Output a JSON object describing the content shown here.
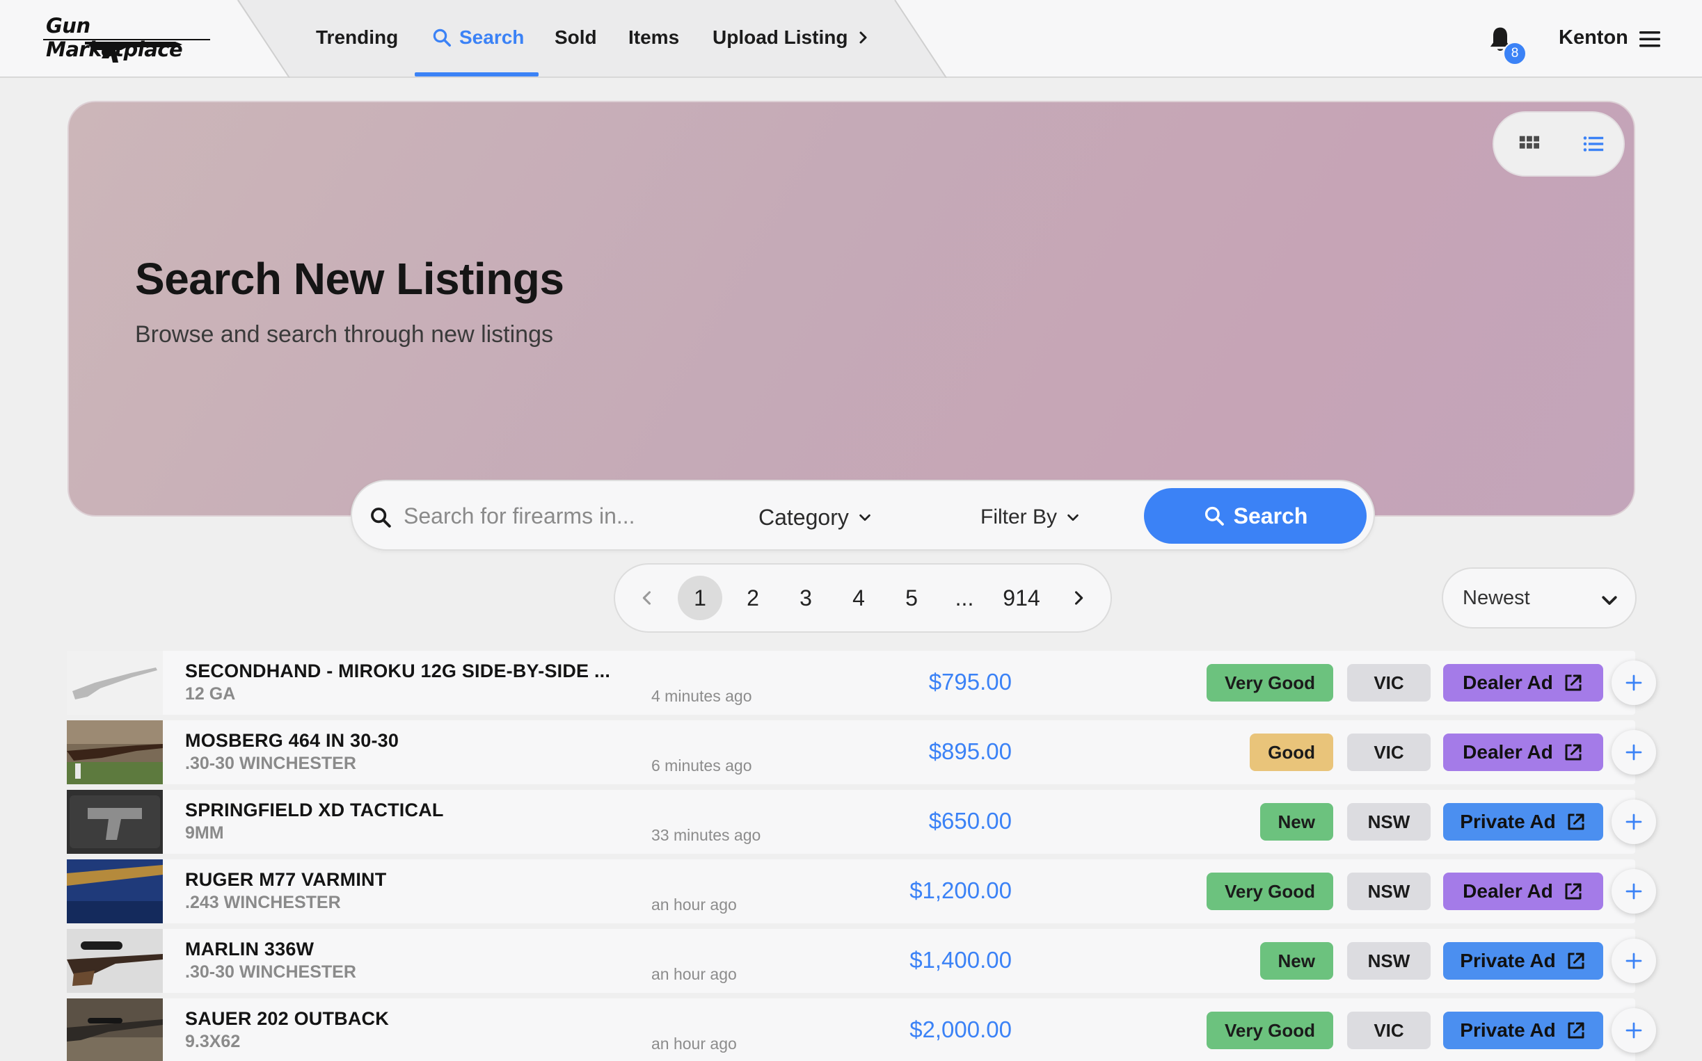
{
  "brand": {
    "name": "Gun Marketplace"
  },
  "nav": {
    "items": [
      {
        "label": "Trending",
        "icon": null
      },
      {
        "label": "Search",
        "icon": "search-icon",
        "active": true
      },
      {
        "label": "Sold"
      },
      {
        "label": "Items"
      },
      {
        "label": "Upload Listing",
        "icon": "chevron-right-icon"
      }
    ],
    "notifications_count": "8",
    "user_name": "Kenton"
  },
  "hero": {
    "title": "Search New Listings",
    "subtitle": "Browse and search through new listings"
  },
  "search": {
    "placeholder": "Search for firearms in...",
    "category_label": "Category",
    "filter_label": "Filter By",
    "button_label": "Search"
  },
  "pagination": {
    "pages": [
      "1",
      "2",
      "3",
      "4",
      "5",
      "...",
      "914"
    ],
    "current": "1"
  },
  "sort": {
    "selected": "Newest"
  },
  "colors": {
    "accent": "#3b82f6",
    "very_good": "#6cc27e",
    "good": "#e9c47a",
    "new": "#6cc27e",
    "dealer_ad": "#a47be8",
    "private_ad": "#4b8ff0"
  },
  "listings": [
    {
      "title": "SECONDHAND - MIROKU 12G SIDE-BY-SIDE ...",
      "caliber": "12 GA",
      "time": "4 minutes ago",
      "price": "$795.00",
      "condition": "Very Good",
      "state": "VIC",
      "ad_type": "Dealer Ad",
      "thumb": "shotgun-photo"
    },
    {
      "title": "MOSBERG 464 IN 30-30",
      "caliber": ".30-30 WINCHESTER",
      "time": "6 minutes ago",
      "price": "$895.00",
      "condition": "Good",
      "state": "VIC",
      "ad_type": "Dealer Ad",
      "thumb": "lever-rifle-photo"
    },
    {
      "title": "SPRINGFIELD XD TACTICAL",
      "caliber": "9MM",
      "time": "33 minutes ago",
      "price": "$650.00",
      "condition": "New",
      "state": "NSW",
      "ad_type": "Private Ad",
      "thumb": "pistol-photo"
    },
    {
      "title": "RUGER M77 VARMINT",
      "caliber": ".243 WINCHESTER",
      "time": "an hour ago",
      "price": "$1,200.00",
      "condition": "Very Good",
      "state": "NSW",
      "ad_type": "Dealer Ad",
      "thumb": "barrel-photo"
    },
    {
      "title": "MARLIN 336W",
      "caliber": ".30-30 WINCHESTER",
      "time": "an hour ago",
      "price": "$1,400.00",
      "condition": "New",
      "state": "NSW",
      "ad_type": "Private Ad",
      "thumb": "scoped-rifle-photo"
    },
    {
      "title": "SAUER 202 OUTBACK",
      "caliber": "9.3X62",
      "time": "an hour ago",
      "price": "$2,000.00",
      "condition": "Very Good",
      "state": "VIC",
      "ad_type": "Private Ad",
      "thumb": "bolt-rifle-photo"
    }
  ]
}
